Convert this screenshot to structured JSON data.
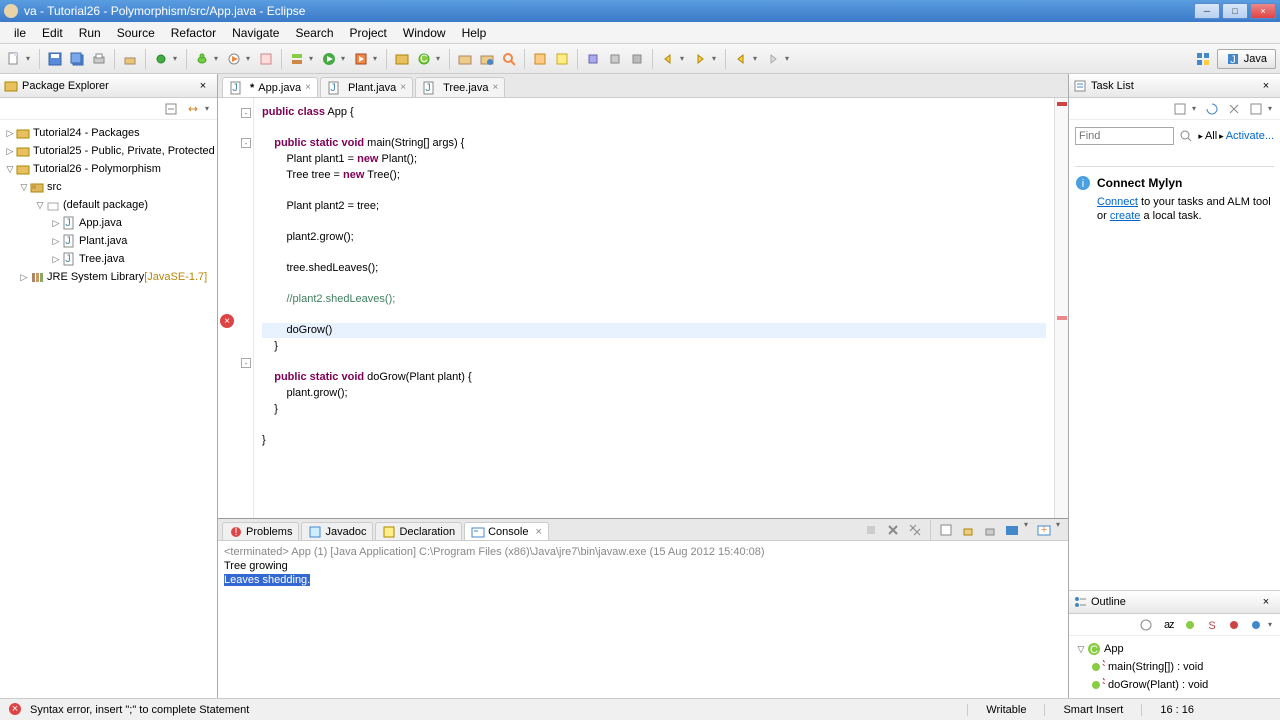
{
  "title": "va - Tutorial26 - Polymorphism/src/App.java - Eclipse",
  "menus": [
    "ile",
    "Edit",
    "Run",
    "Source",
    "Refactor",
    "Navigate",
    "Search",
    "Project",
    "Window",
    "Help"
  ],
  "perspective": "Java",
  "package_explorer": {
    "title": "Package Explorer",
    "nodes": {
      "p1": "Tutorial24 - Packages",
      "p2": "Tutorial25 - Public, Private, Protected",
      "p3": "Tutorial26 - Polymorphism",
      "src": "src",
      "pkg": "(default package)",
      "f1": "App.java",
      "f2": "Plant.java",
      "f3": "Tree.java",
      "jre": "JRE System Library",
      "jre_v": "[JavaSE-1.7]"
    }
  },
  "editor": {
    "tabs": [
      {
        "label": "App.java",
        "dirty": true,
        "active": true
      },
      {
        "label": "Plant.java",
        "dirty": false,
        "active": false
      },
      {
        "label": "Tree.java",
        "dirty": false,
        "active": false
      }
    ],
    "code": {
      "l1a": "public",
      "l1b": " class",
      "l1c": " App {",
      "l3a": "    public",
      "l3b": " static",
      "l3c": " void",
      "l3d": " main(String[] args) {",
      "l4a": "        Plant plant1 = ",
      "l4b": "new",
      "l4c": " Plant();",
      "l5a": "        Tree tree = ",
      "l5b": "new",
      "l5c": " Tree();",
      "l7": "        Plant plant2 = tree;",
      "l9": "        plant2.grow();",
      "l11": "        tree.shedLeaves();",
      "l13": "        //plant2.shedLeaves();",
      "l15": "        doGrow()",
      "l16": "    }",
      "l18a": "    public",
      "l18b": " static",
      "l18c": " void",
      "l18d": " doGrow(Plant plant) {",
      "l19": "        plant.grow();",
      "l20": "    }",
      "l22": "}"
    }
  },
  "tasklist": {
    "title": "Task List",
    "find_placeholder": "Find",
    "all": "All",
    "activate": "Activate...",
    "mylyn_title": "Connect Mylyn",
    "mylyn_connect": "Connect",
    "mylyn_text1": " to your tasks and ALM tool",
    "mylyn_or": "or ",
    "mylyn_create": "create",
    "mylyn_text2": " a local task."
  },
  "outline": {
    "title": "Outline",
    "root": "App",
    "m1": "main(String[]) : void",
    "m2": "doGrow(Plant) : void"
  },
  "bottom": {
    "tabs": [
      "Problems",
      "Javadoc",
      "Declaration",
      "Console"
    ],
    "launch": "<terminated> App (1) [Java Application] C:\\Program Files (x86)\\Java\\jre7\\bin\\javaw.exe (15 Aug 2012 15:40:08)",
    "out1": "Tree growing",
    "out2": "Leaves shedding."
  },
  "status": {
    "msg": "Syntax error, insert \";\" to complete Statement",
    "writable": "Writable",
    "insert": "Smart Insert",
    "pos": "16 : 16"
  }
}
